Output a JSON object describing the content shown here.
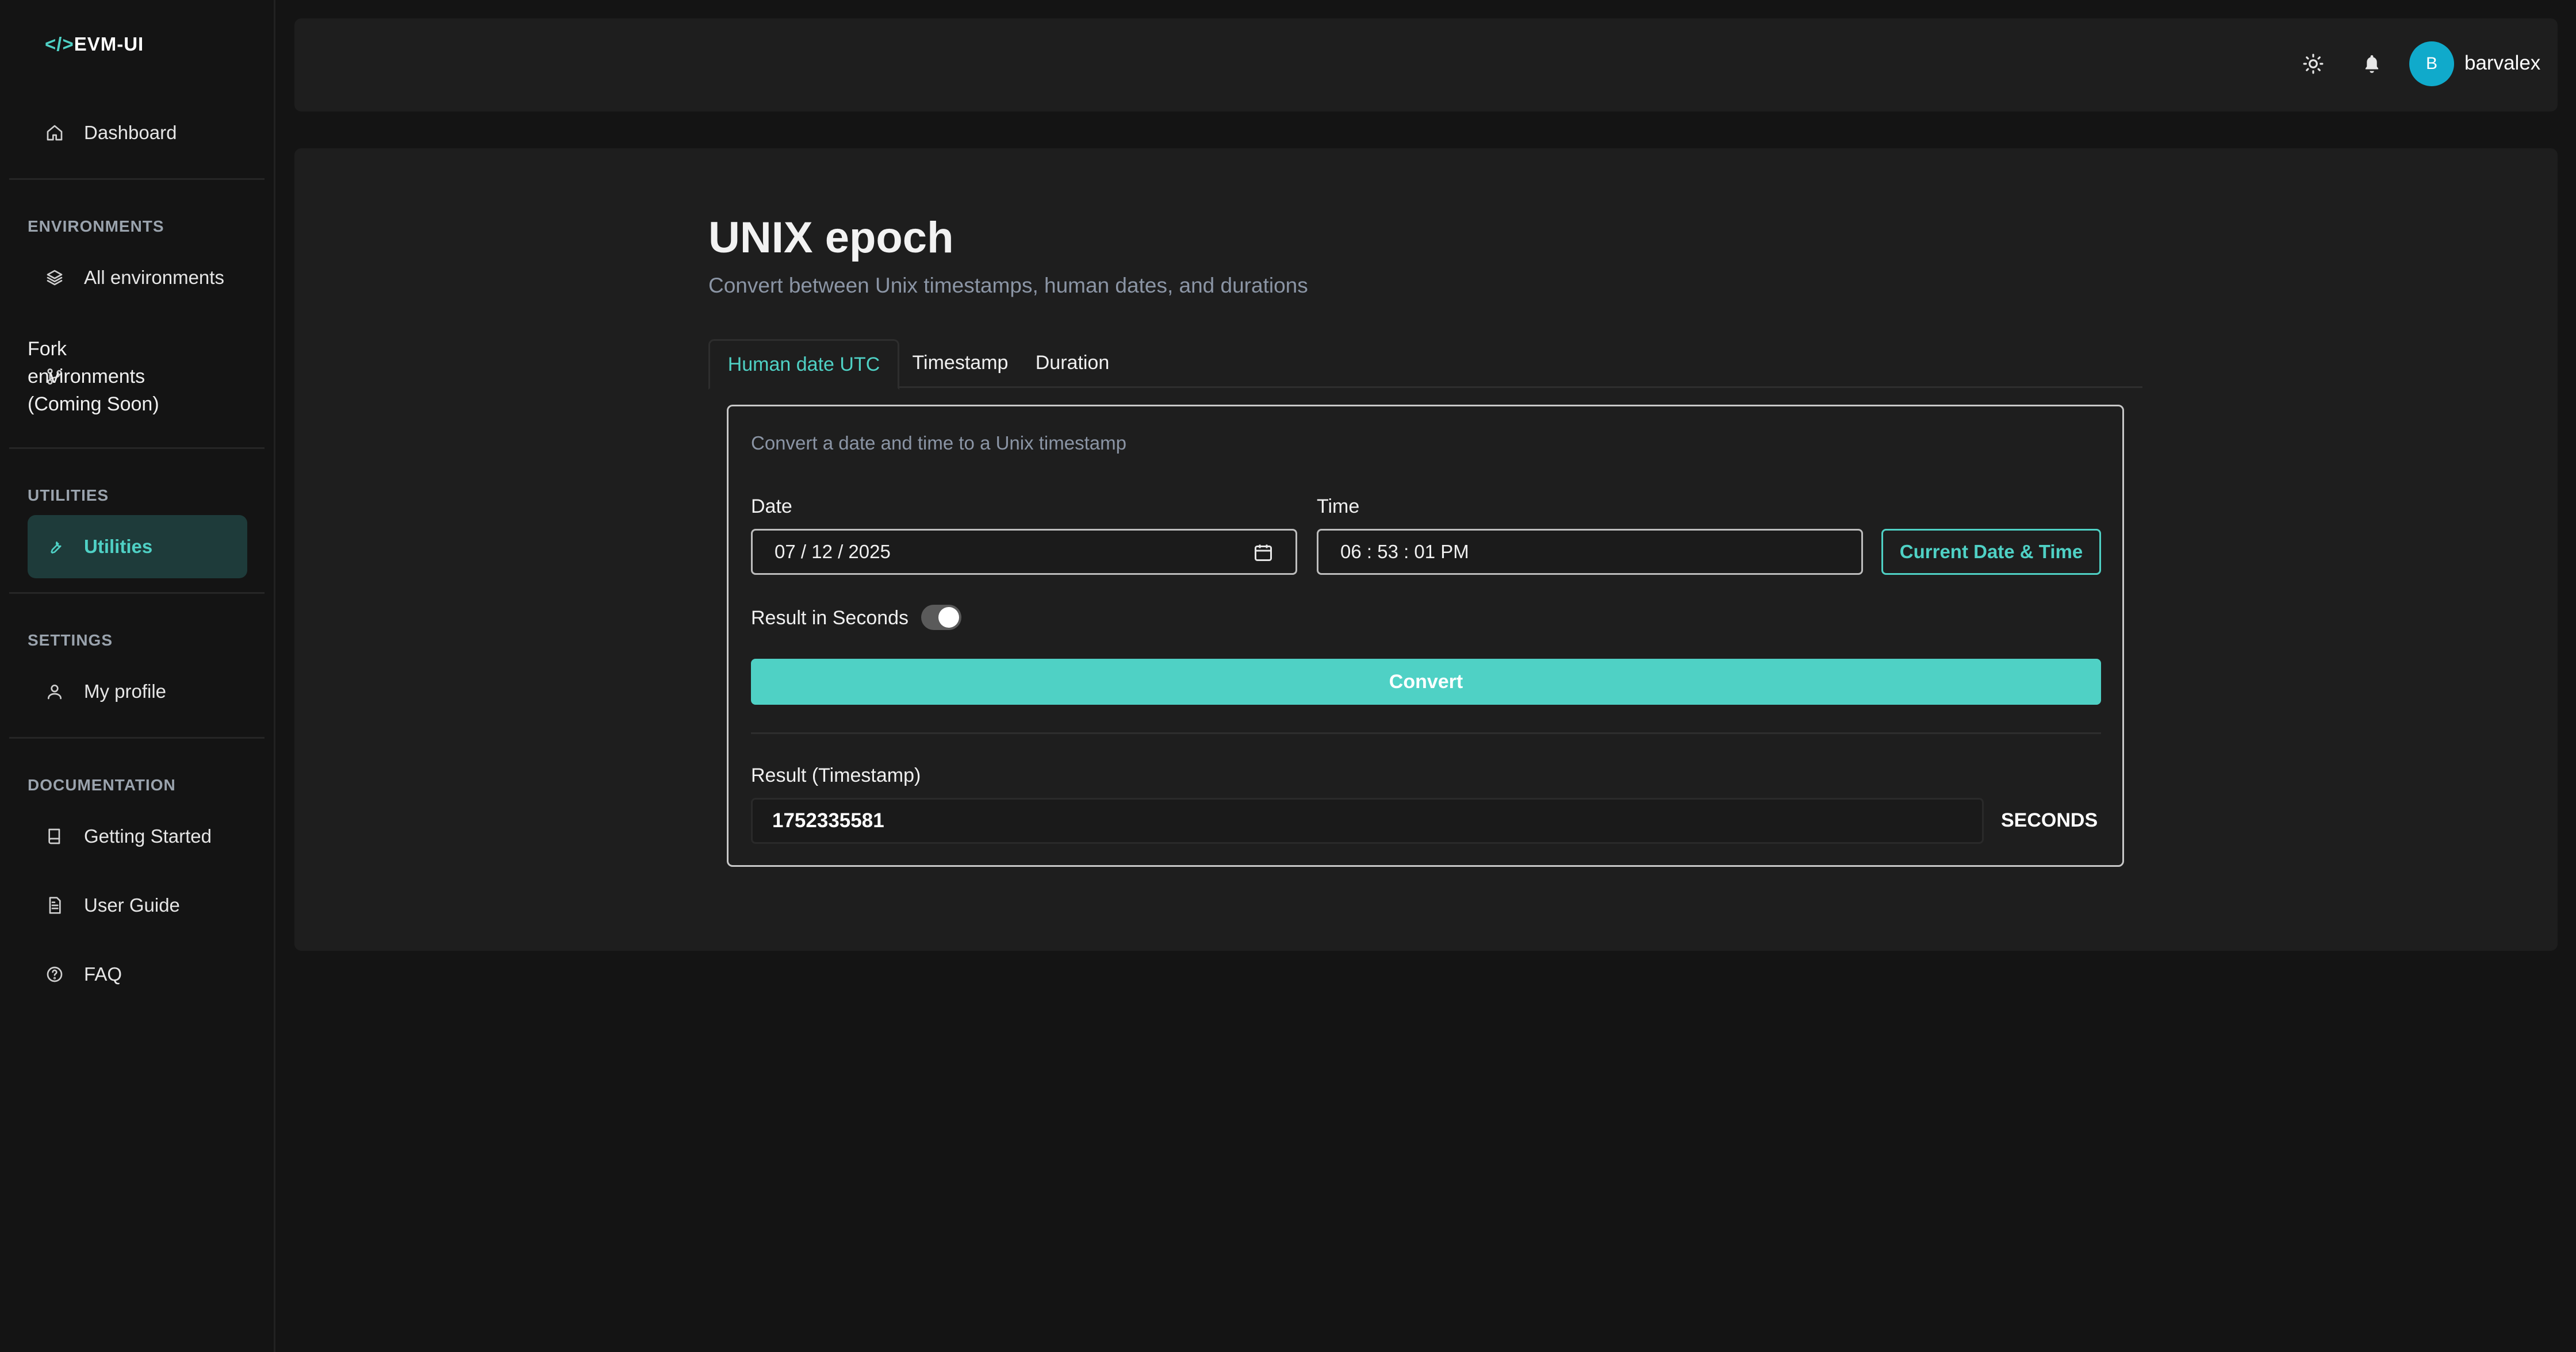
{
  "app": {
    "logo_brackets": "</>",
    "logo_text": "EVM-UI"
  },
  "sidebar": {
    "dashboard": "Dashboard",
    "sections": {
      "environments": "ENVIRONMENTS",
      "utilities": "UTILITIES",
      "settings": "SETTINGS",
      "documentation": "DOCUMENTATION"
    },
    "all_environments": "All environments",
    "fork_environments": [
      "Fork",
      "environments",
      "(Coming Soon)"
    ],
    "utilities": "Utilities",
    "my_profile": "My profile",
    "getting_started": "Getting Started",
    "user_guide": "User Guide",
    "faq": "FAQ",
    "active_item": "Utilities"
  },
  "topbar": {
    "avatar_initial": "B",
    "username": "barvalex",
    "icons": [
      "sun-icon",
      "bell-icon"
    ]
  },
  "page": {
    "title": "UNIX epoch",
    "subtitle": "Convert between Unix timestamps, human dates, and durations",
    "tabs": [
      "Human date UTC",
      "Timestamp",
      "Duration"
    ],
    "active_tab": "Human date UTC"
  },
  "form": {
    "description": "Convert a date and time to a Unix timestamp",
    "date_label": "Date",
    "date_value": "07 / 12 / 2025",
    "time_label": "Time",
    "time_value": "06 : 53 : 01  PM",
    "current_button": "Current Date & Time",
    "toggle_label": "Result in Seconds",
    "toggle_on": true,
    "convert_button": "Convert",
    "result_label": "Result (Timestamp)",
    "result_value": "1752335581",
    "result_unit": "SECONDS"
  },
  "colors": {
    "accent": "#4fd1c5",
    "avatar": "#10aacb",
    "background": "#141414",
    "panel": "#1e1e1e"
  }
}
